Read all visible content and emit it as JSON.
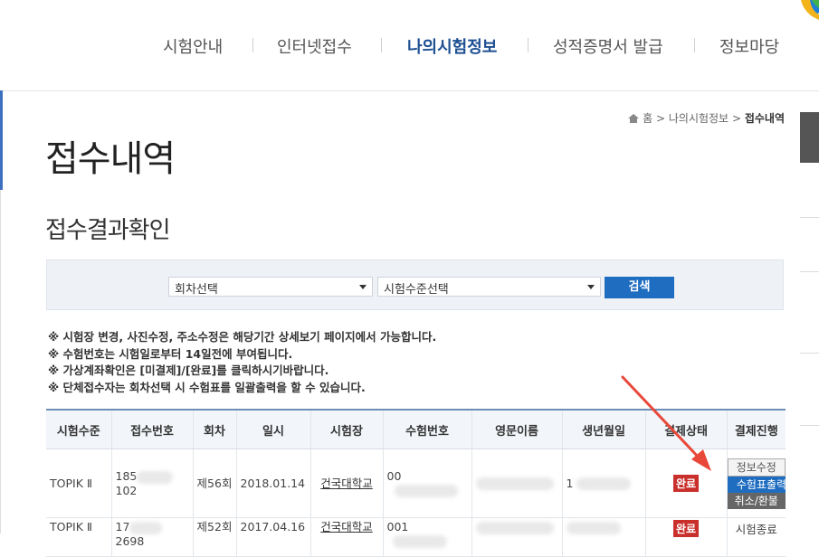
{
  "nav": {
    "items": [
      {
        "label": "시험안내",
        "active": false
      },
      {
        "label": "인터넷접수",
        "active": false
      },
      {
        "label": "나의시험정보",
        "active": true
      },
      {
        "label": "성적증명서 발급",
        "active": false
      },
      {
        "label": "정보마당",
        "active": false
      }
    ],
    "active_color": "#1d4f91"
  },
  "breadcrumb": {
    "home": "홈",
    "sep": ">",
    "parent": "나의시험정보",
    "current": "접수내역"
  },
  "page_title": "접수내역",
  "section_title": "접수결과확인",
  "search": {
    "round_select": "회차선택",
    "level_select": "시험수준선택",
    "search_label": "검색"
  },
  "notices": [
    "※ 시험장 변경, 사진수정, 주소수정은 해당기간 상세보기 페이지에서 가능합니다.",
    "※ 수험번호는 시험일로부터 14일전에 부여됩니다.",
    "※ 가상계좌확인은 [미결제]/[완료]를 클릭하시기바랍니다.",
    "※ 단체접수자는 회차선택 시 수험표를 일괄출력을 할 수 있습니다."
  ],
  "table": {
    "headers": [
      "시험수준",
      "접수번호",
      "회차",
      "일시",
      "시험장",
      "수험번호",
      "영문이름",
      "생년월일",
      "결제상태",
      "결제진행"
    ],
    "rows": [
      {
        "level": "TOPIK Ⅱ",
        "reg_prefix": "185",
        "reg_suffix": "102",
        "round": "제56회",
        "date": "2018.01.14",
        "venue": "건국대학교",
        "exam_no_prefix": "00",
        "birth_prefix": "1",
        "status": "완료",
        "actions": [
          "정보수정",
          "수험표출력",
          "취소/환불"
        ]
      },
      {
        "level": "TOPIK Ⅱ",
        "reg_prefix": "17",
        "reg_suffix": "2698",
        "round": "제52회",
        "date": "2017.04.16",
        "venue": "건국대학교",
        "exam_no_prefix": "001",
        "birth_prefix": "",
        "status": "완료",
        "actions": [
          "시험종료"
        ]
      }
    ]
  },
  "colors": {
    "accent_blue": "#1f6dc1",
    "status_red": "#c9302c",
    "arrow_red": "#e8483a"
  }
}
